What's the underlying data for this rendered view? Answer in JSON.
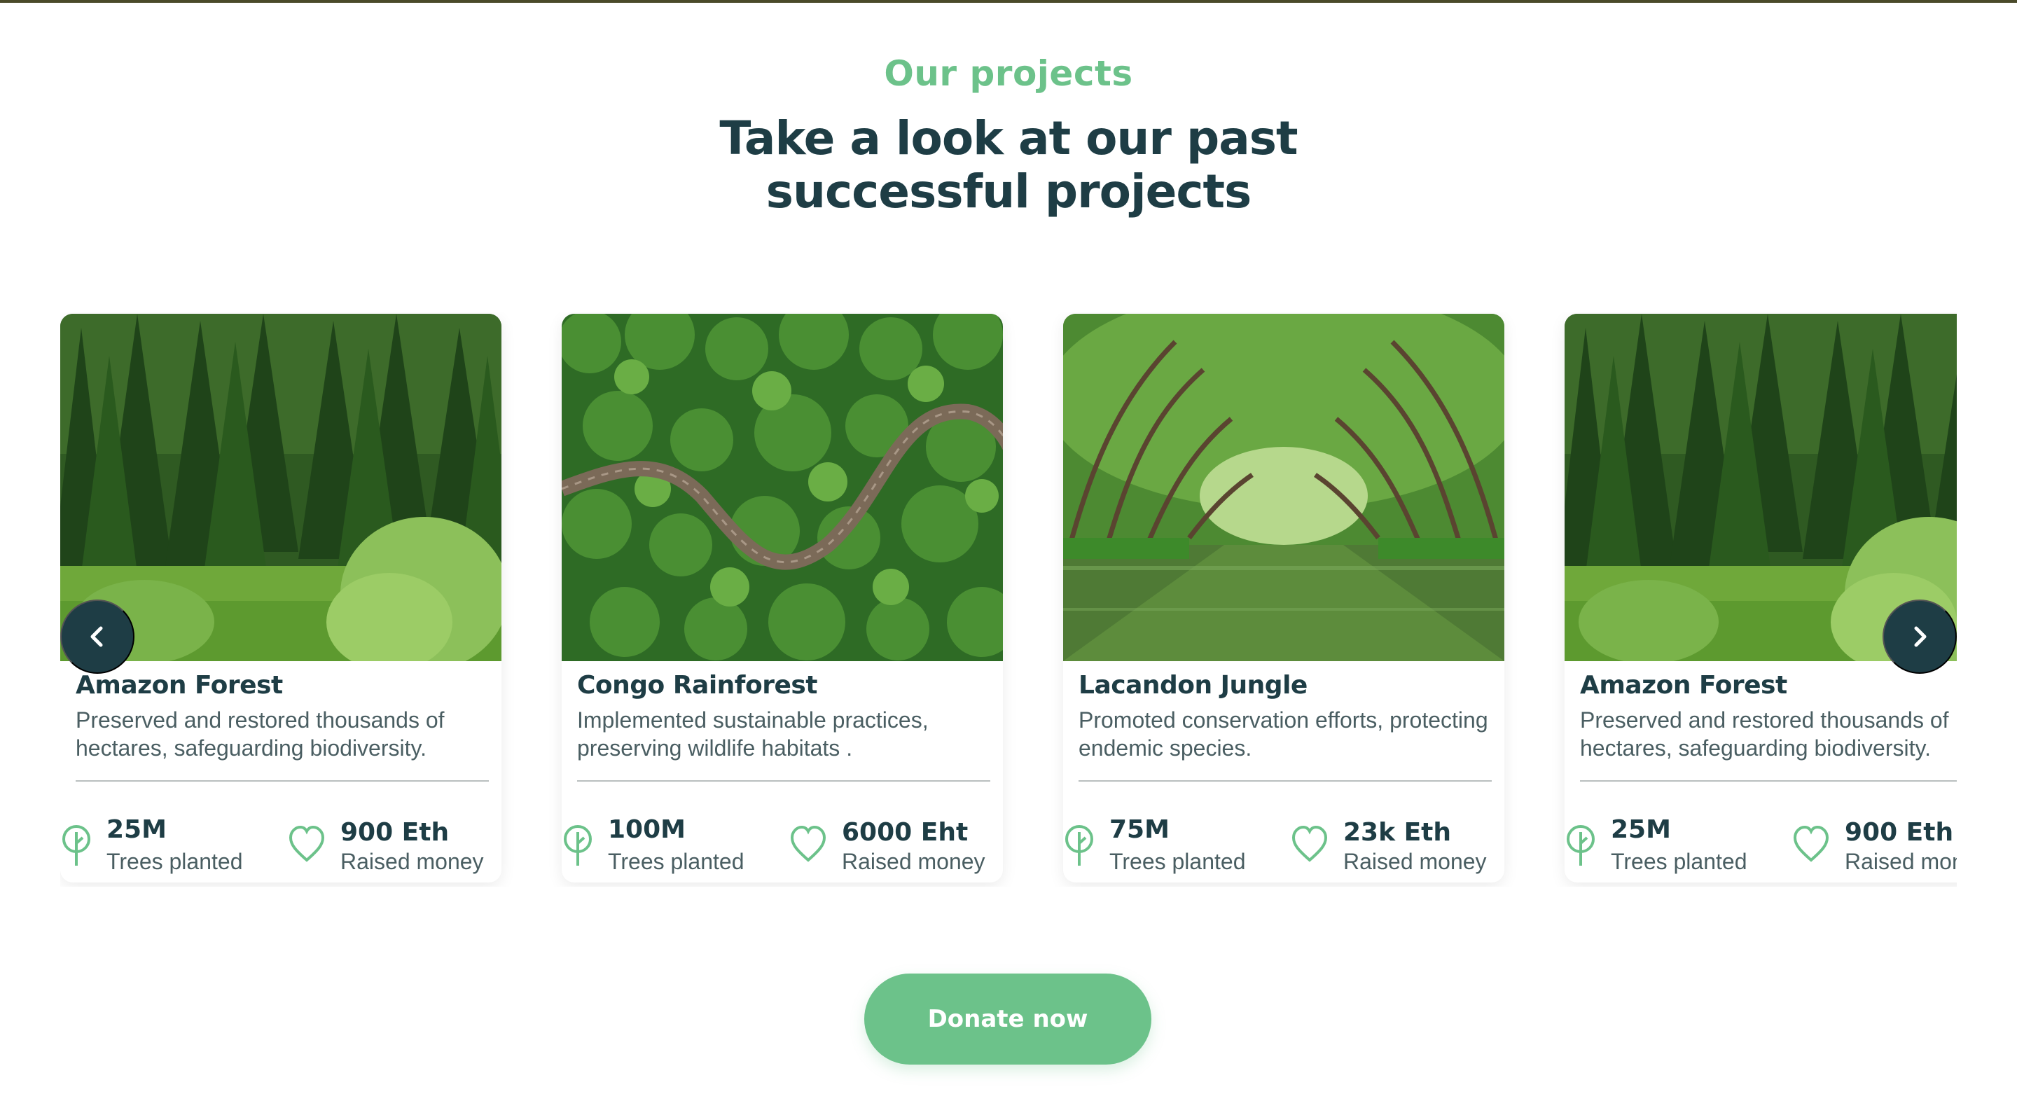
{
  "section": {
    "eyebrow": "Our projects",
    "heading_line1": "Take a look at our past",
    "heading_line2": "successful projects"
  },
  "projects": [
    {
      "title": "Amazon Forest",
      "description": "Preserved and restored thousands of hectares, safeguarding biodiversity.",
      "trees_value": "25M",
      "trees_label": "Trees planted",
      "money_value": "900 Eth",
      "money_label": "Raised money",
      "image": "pine-forest-meadow"
    },
    {
      "title": "Congo Rainforest",
      "description": "Implemented sustainable practices, preserving wildlife habitats .",
      "trees_value": "100M",
      "trees_label": "Trees planted",
      "money_value": "6000 Eht",
      "money_label": "Raised money",
      "image": "aerial-forest-road"
    },
    {
      "title": "Lacandon Jungle",
      "description": "Promoted conservation efforts, protecting endemic species.",
      "trees_value": "75M",
      "trees_label": "Trees planted",
      "money_value": "23k Eth",
      "money_label": "Raised money",
      "image": "mangrove-river"
    },
    {
      "title": "Amazon Forest",
      "description": "Preserved and restored thousands of hectares, safeguarding biodiversity.",
      "trees_value": "25M",
      "trees_label": "Trees planted",
      "money_value": "900 Eth",
      "money_label": "Raised money",
      "image": "pine-forest-meadow"
    }
  ],
  "controls": {
    "prev_icon": "chevron-left-icon",
    "next_icon": "chevron-right-icon"
  },
  "cta": {
    "donate_label": "Donate now"
  },
  "colors": {
    "accent": "#6cc28a",
    "heading": "#1e3d45",
    "body_text": "#4a5e62"
  }
}
